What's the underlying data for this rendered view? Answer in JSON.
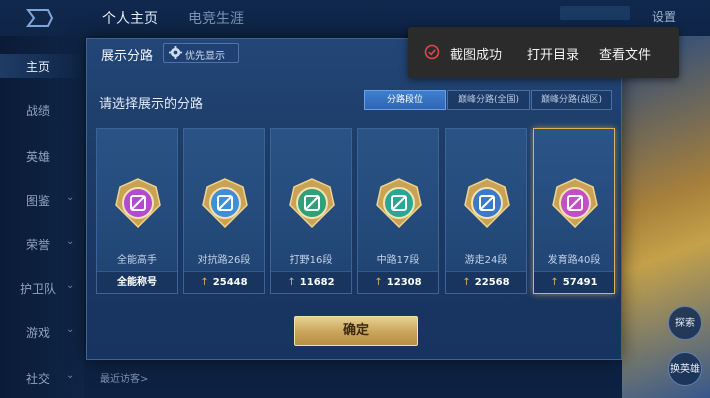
{
  "app": {
    "top_tabs": [
      "个人主页",
      "电竞生涯"
    ],
    "settings_label": "设置",
    "sidebar": [
      {
        "label": "主页",
        "active": true,
        "chevron": false
      },
      {
        "label": "战绩",
        "active": false,
        "chevron": false
      },
      {
        "label": "英雄",
        "active": false,
        "chevron": false
      },
      {
        "label": "图鉴",
        "active": false,
        "chevron": true
      },
      {
        "label": "荣誉",
        "active": false,
        "chevron": true
      },
      {
        "label": "护卫队",
        "active": false,
        "chevron": true
      },
      {
        "label": "游戏",
        "active": false,
        "chevron": true
      },
      {
        "label": "社交",
        "active": false,
        "chevron": true
      }
    ],
    "recent_visitors_label": "最近访客>",
    "right_buttons": [
      "探索",
      "换英雄"
    ]
  },
  "dialog": {
    "title": "展示分路",
    "priority_button": "优先显示",
    "subtitle": "请选择展示的分路",
    "segments": [
      {
        "label": "分路段位",
        "active": true
      },
      {
        "label": "巅峰分路(全国)",
        "active": false
      },
      {
        "label": "巅峰分路(战区)",
        "active": false
      }
    ],
    "cards": [
      {
        "name": "全能高手",
        "score": "全能称号",
        "show_arrow": false,
        "emblem_color": "#b24bd0",
        "selected": false
      },
      {
        "name": "对抗路26段",
        "score": "25448",
        "show_arrow": true,
        "emblem_color": "#3f8fd8",
        "selected": false
      },
      {
        "name": "打野16段",
        "score": "11682",
        "show_arrow": true,
        "emblem_color": "#2fa07a",
        "selected": false
      },
      {
        "name": "中路17段",
        "score": "12308",
        "show_arrow": true,
        "emblem_color": "#2aa694",
        "selected": false
      },
      {
        "name": "游走24段",
        "score": "22568",
        "show_arrow": true,
        "emblem_color": "#3a78c8",
        "selected": false
      },
      {
        "name": "发育路40段",
        "score": "57491",
        "show_arrow": true,
        "emblem_color": "#c24fc8",
        "selected": true
      }
    ],
    "confirm_label": "确定"
  },
  "toast": {
    "message": "截图成功",
    "open_folder": "打开目录",
    "view_file": "查看文件",
    "icon": "check-circle-icon",
    "icon_color": "#e0474c"
  }
}
